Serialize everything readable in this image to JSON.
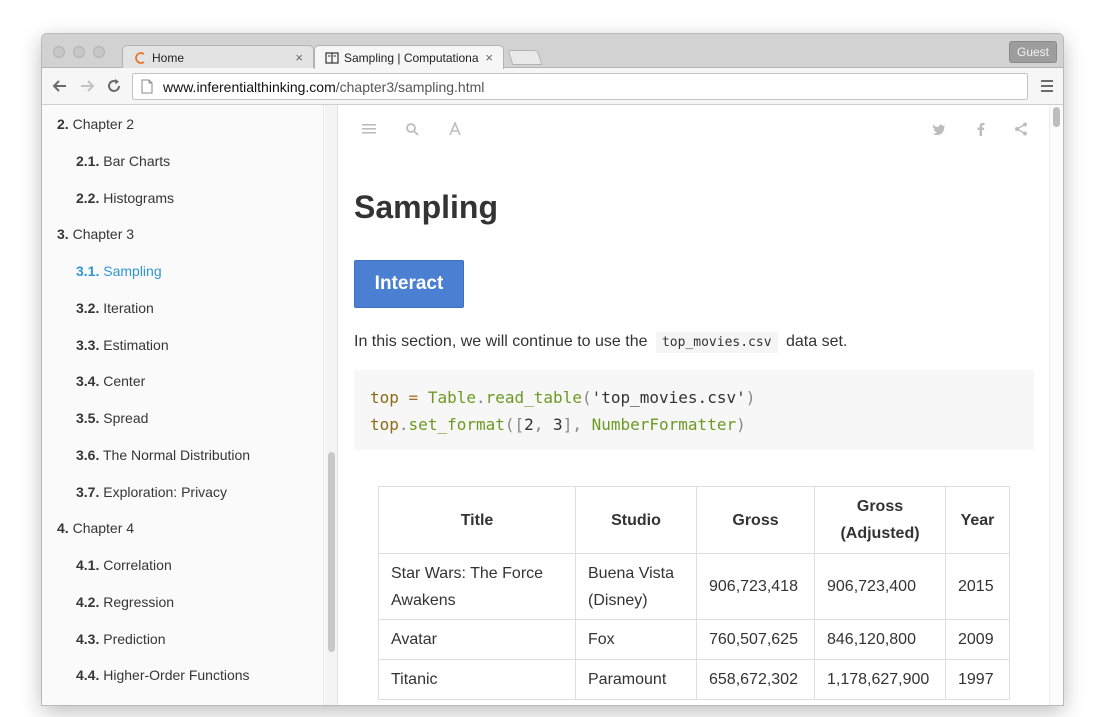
{
  "browser": {
    "tabs": [
      {
        "label": "Home",
        "close": "×"
      },
      {
        "label": "Sampling | Computational and",
        "close": "×"
      }
    ],
    "guest_label": "Guest",
    "url_host": "www.inferentialthinking.com",
    "url_path": "/chapter3/sampling.html"
  },
  "sidebar": {
    "items": [
      {
        "num": "2.",
        "label": "Chapter 2"
      },
      {
        "num": "2.1.",
        "label": "Bar Charts"
      },
      {
        "num": "2.2.",
        "label": "Histograms"
      },
      {
        "num": "3.",
        "label": "Chapter 3"
      },
      {
        "num": "3.1.",
        "label": "Sampling"
      },
      {
        "num": "3.2.",
        "label": "Iteration"
      },
      {
        "num": "3.3.",
        "label": "Estimation"
      },
      {
        "num": "3.4.",
        "label": "Center"
      },
      {
        "num": "3.5.",
        "label": "Spread"
      },
      {
        "num": "3.6.",
        "label": "The Normal Distribution"
      },
      {
        "num": "3.7.",
        "label": "Exploration: Privacy"
      },
      {
        "num": "4.",
        "label": "Chapter 4"
      },
      {
        "num": "4.1.",
        "label": "Correlation"
      },
      {
        "num": "4.2.",
        "label": "Regression"
      },
      {
        "num": "4.3.",
        "label": "Prediction"
      },
      {
        "num": "4.4.",
        "label": "Higher-Order Functions"
      }
    ],
    "active_index": 4
  },
  "main": {
    "title": "Sampling",
    "interact_label": "Interact",
    "intro_before": "In this section, we will continue to use the",
    "intro_code": "top_movies.csv",
    "intro_after": "data set.",
    "code": {
      "l1_var": "top",
      "l1_eq": " = ",
      "l1_cls": "Table",
      "l1_dot": ".",
      "l1_fn": "read_table",
      "l1_open": "(",
      "l1_str": "'top_movies.csv'",
      "l1_close": ")",
      "l2_var": "top",
      "l2_dot": ".",
      "l2_fn": "set_format",
      "l2_open": "([",
      "l2_n1": "2",
      "l2_comma": ", ",
      "l2_n2": "3",
      "l2_mid": "], ",
      "l2_cls": "NumberFormatter",
      "l2_close": ")"
    },
    "table": {
      "headers": [
        "Title",
        "Studio",
        "Gross",
        "Gross (Adjusted)",
        "Year"
      ],
      "rows": [
        [
          "Star Wars: The Force Awakens",
          "Buena Vista (Disney)",
          "906,723,418",
          "906,723,400",
          "2015"
        ],
        [
          "Avatar",
          "Fox",
          "760,507,625",
          "846,120,800",
          "2009"
        ],
        [
          "Titanic",
          "Paramount",
          "658,672,302",
          "1,178,627,900",
          "1997"
        ]
      ]
    }
  },
  "colors": {
    "active_link": "#2e97d3",
    "interact_button": "#4a7fd1",
    "code_class": "#6c9a22",
    "code_var": "#8c6b15"
  }
}
